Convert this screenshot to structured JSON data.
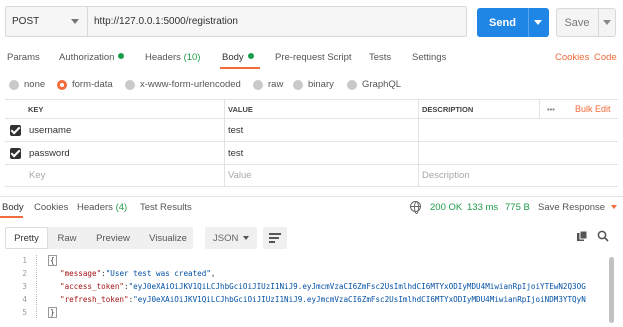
{
  "request": {
    "method": "POST",
    "url": "http://127.0.0.1:5000/registration",
    "send_label": "Send",
    "save_label": "Save"
  },
  "request_tabs": {
    "params": "Params",
    "authorization": "Authorization",
    "headers": "Headers",
    "headers_count": "(10)",
    "body": "Body",
    "prerequest": "Pre-request Script",
    "tests": "Tests",
    "settings": "Settings",
    "cookies": "Cookies",
    "code": "Code"
  },
  "body_modes": {
    "none": "none",
    "form_data": "form-data",
    "urlencoded": "x-www-form-urlencoded",
    "raw": "raw",
    "binary": "binary",
    "graphql": "GraphQL",
    "selected": "form-data"
  },
  "table": {
    "col_key": "KEY",
    "col_value": "VALUE",
    "col_description": "DESCRIPTION",
    "more": "•••",
    "bulk_edit": "Bulk Edit",
    "rows": [
      {
        "key": "username",
        "value": "test",
        "description": "",
        "checked": true
      },
      {
        "key": "password",
        "value": "test",
        "description": "",
        "checked": true
      }
    ],
    "placeholder": {
      "key": "Key",
      "value": "Value",
      "description": "Description"
    }
  },
  "response": {
    "tabs": {
      "body": "Body",
      "cookies": "Cookies",
      "headers": "Headers",
      "headers_count": "(4)",
      "test_results": "Test Results"
    },
    "status": "200 OK",
    "time": "133 ms",
    "size": "775 B",
    "save_response": "Save Response",
    "views": {
      "pretty": "Pretty",
      "raw": "Raw",
      "preview": "Preview",
      "visualize": "Visualize",
      "selected": "Pretty"
    },
    "format": "JSON",
    "lines": [
      {
        "num": "1",
        "text": "{"
      },
      {
        "num": "2",
        "key": "\"message\"",
        "value": "\"User test was created\"",
        "trail": ","
      },
      {
        "num": "3",
        "key": "\"access_token\"",
        "value": "\"eyJ0eXAiOiJKV1QiLCJhbGciOiJIUzI1NiJ9.eyJmcmVzaCI6ZmFsc2UsImlhdCI6MTYxODIyMDU4MiwianRpIjoiYTEwN2Q3OG",
        "trail": ""
      },
      {
        "num": "4",
        "key": "\"refresh_token\"",
        "value": "\"eyJ0eXAiOiJKV1QiLCJhbGciOiJIUzI1NiJ9.eyJmcmVzaCI6ZmFsc2UsImlhdCI6MTYxODIyMDU4MiwianRpIjoiNDM3YTQyN",
        "trail": ""
      },
      {
        "num": "5",
        "text": "}"
      }
    ]
  },
  "colors": {
    "accent": "#f26b3a",
    "send": "#1f86e6",
    "success": "#1e9c4a"
  }
}
